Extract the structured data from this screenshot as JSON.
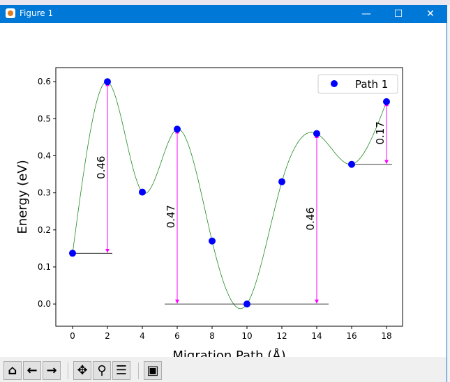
{
  "window": {
    "title": "Figure 1",
    "minimize_icon": "minimize-icon",
    "maximize_icon": "maximize-icon",
    "close_icon": "close-icon"
  },
  "toolbar": {
    "buttons": [
      {
        "name": "home",
        "icon": "home-icon",
        "glyph": "⌂"
      },
      {
        "name": "back",
        "icon": "arrow-left-icon",
        "glyph": "←"
      },
      {
        "name": "forward",
        "icon": "arrow-right-icon",
        "glyph": "→"
      },
      {
        "name": "pan",
        "icon": "move-icon",
        "glyph": "✥"
      },
      {
        "name": "zoom",
        "icon": "magnifier-icon",
        "glyph": "⚲"
      },
      {
        "name": "configure",
        "icon": "sliders-icon",
        "glyph": "☰"
      },
      {
        "name": "save",
        "icon": "floppy-disk-icon",
        "glyph": "▣"
      }
    ]
  },
  "chart_data": {
    "type": "scatter",
    "xlabel": "Migration Path (Å)",
    "ylabel": "Energy (eV)",
    "xlim": [
      -0.96,
      18.92
    ],
    "ylim": [
      -0.06,
      0.638
    ],
    "xticks": [
      0,
      2,
      4,
      6,
      8,
      10,
      12,
      14,
      16,
      18
    ],
    "yticks": [
      0.0,
      0.1,
      0.2,
      0.3,
      0.4,
      0.5,
      0.6
    ],
    "ytick_labels": [
      "0.0",
      "0.1",
      "0.2",
      "0.3",
      "0.4",
      "0.5",
      "0.6"
    ],
    "grid": false,
    "legend": {
      "placement": "top-right",
      "entries": [
        "Path 1"
      ]
    },
    "series": [
      {
        "name": "Path 1",
        "color": "#0000ff",
        "x": [
          0,
          2,
          4,
          6,
          8,
          10,
          12,
          14,
          16,
          18
        ],
        "y": [
          0.137,
          0.6,
          0.302,
          0.472,
          0.17,
          0.0,
          0.33,
          0.46,
          0.377,
          0.546
        ]
      }
    ],
    "spline_color": "#228b22",
    "arrow_color": "#ff00ff",
    "baselines": [
      {
        "y": 0.137,
        "x0": 0,
        "x1": 2.28
      },
      {
        "y": 0.0,
        "x0": 5.28,
        "x1": 14.68
      },
      {
        "y": 0.377,
        "x0": 16,
        "x1": 18.32
      }
    ],
    "barriers": [
      {
        "x": 2,
        "y0": 0.137,
        "y1": 0.6,
        "label": "0.46"
      },
      {
        "x": 6,
        "y0": 0.0,
        "y1": 0.472,
        "label": "0.47"
      },
      {
        "x": 14,
        "y0": 0.0,
        "y1": 0.46,
        "label": "0.46"
      },
      {
        "x": 18,
        "y0": 0.377,
        "y1": 0.546,
        "label": "0.17"
      }
    ]
  }
}
